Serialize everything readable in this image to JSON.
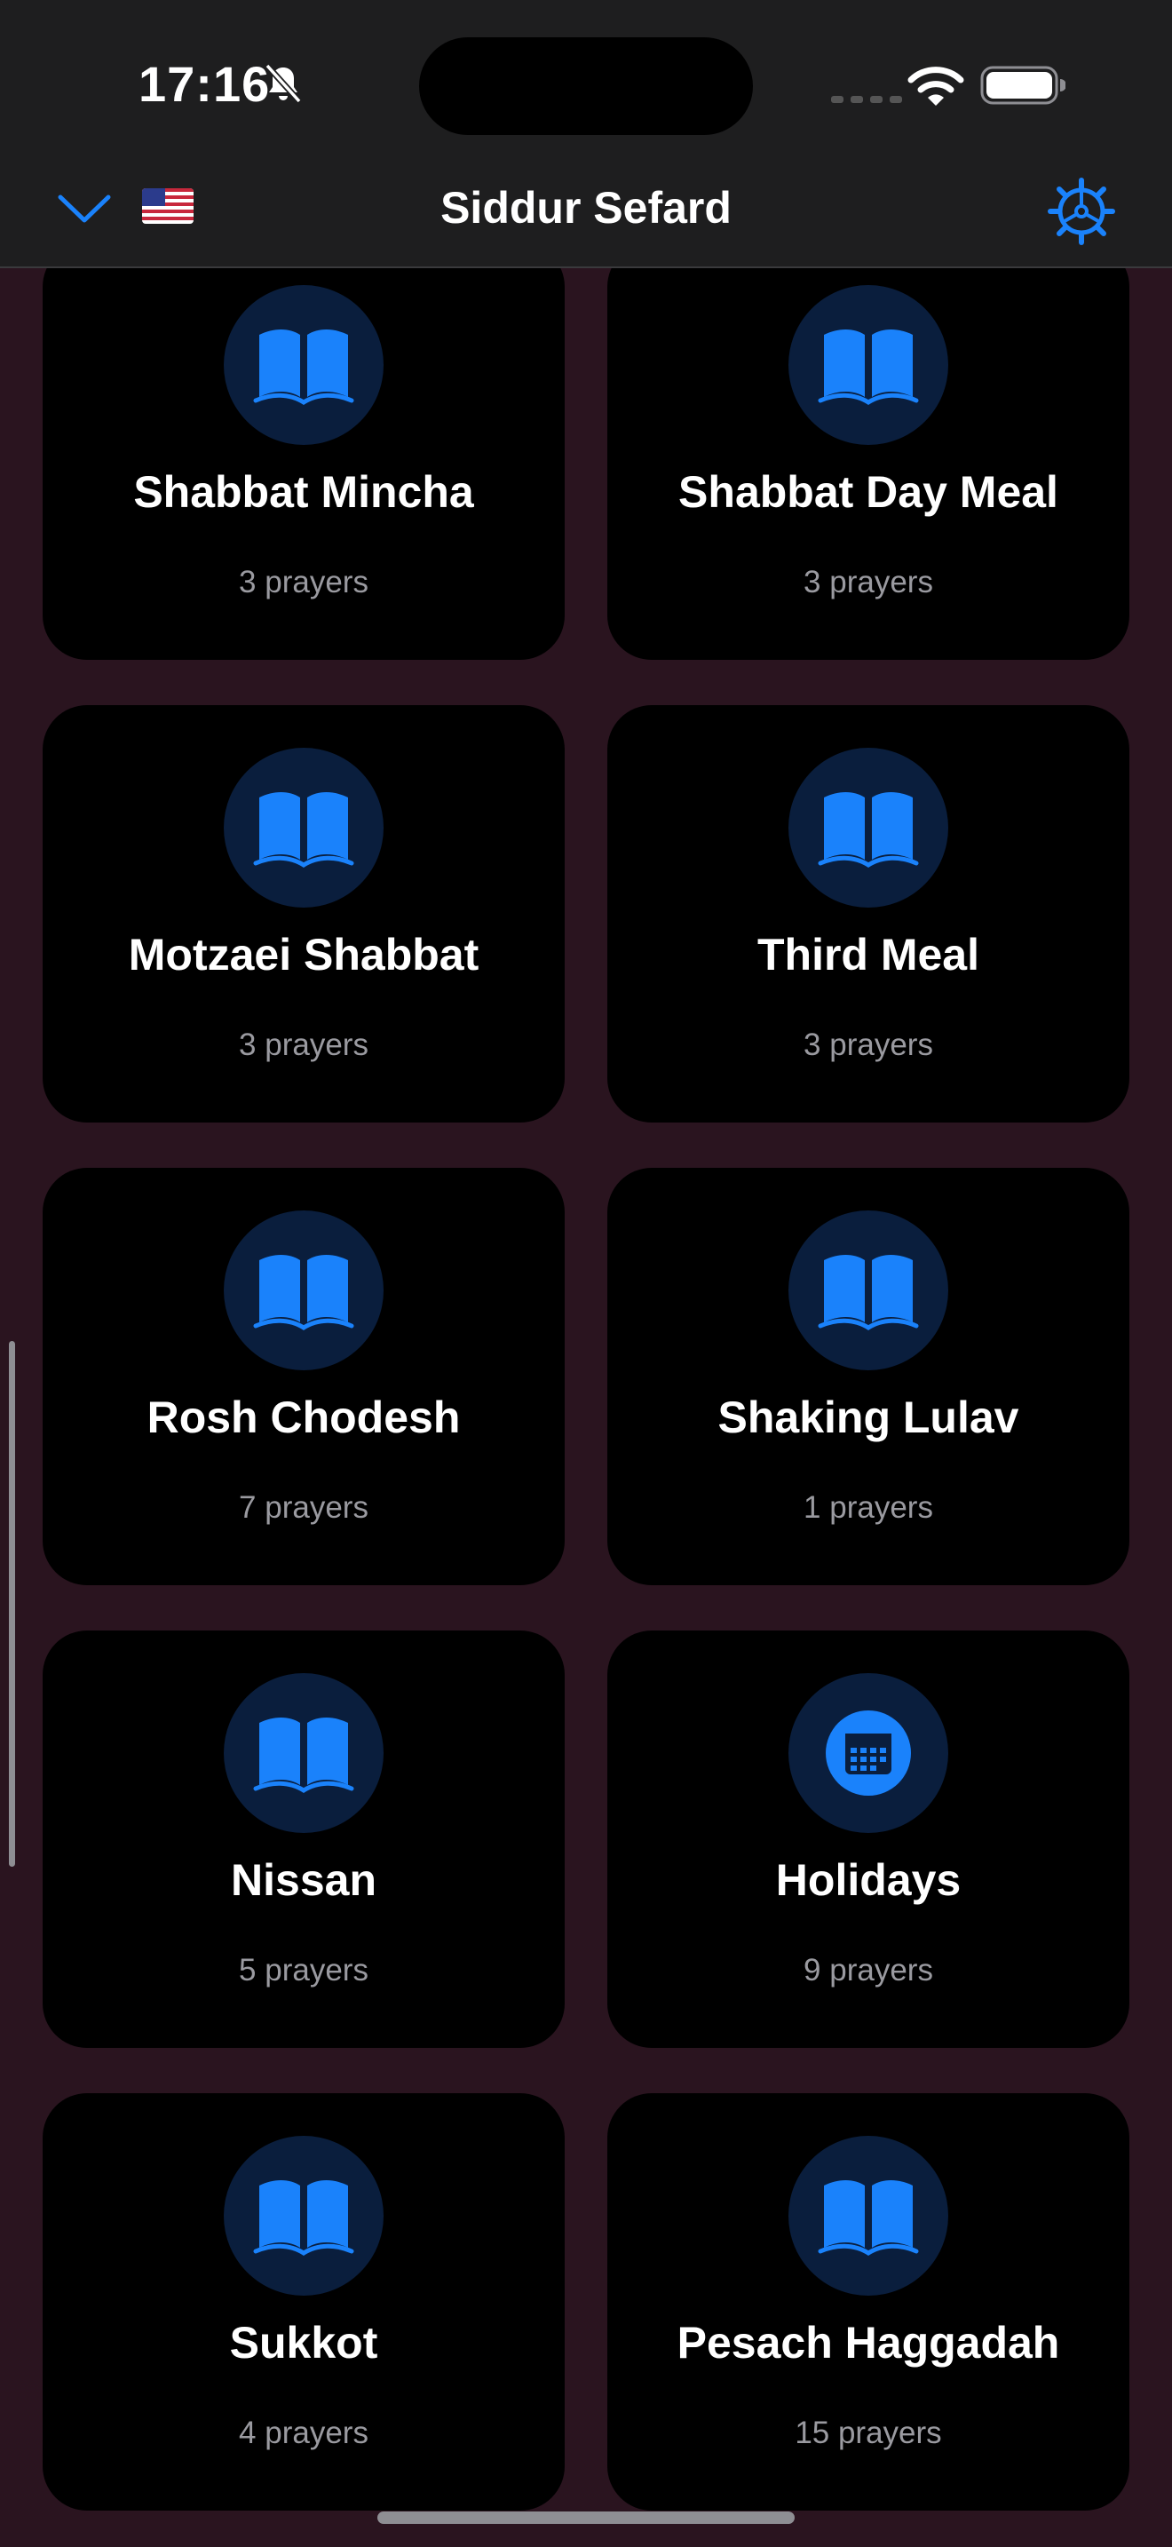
{
  "status_bar": {
    "time": "17:16"
  },
  "header": {
    "title": "Siddur Sefard"
  },
  "colors": {
    "accent": "#1a82fb",
    "card_bg": "#000000",
    "background": "#2a141f"
  },
  "categories": [
    {
      "title": "Shabbat Mincha",
      "count": "3 prayers",
      "icon": "book-icon"
    },
    {
      "title": "Shabbat Day Meal",
      "count": "3 prayers",
      "icon": "book-icon"
    },
    {
      "title": "Motzaei Shabbat",
      "count": "3 prayers",
      "icon": "book-icon"
    },
    {
      "title": "Third Meal",
      "count": "3 prayers",
      "icon": "book-icon"
    },
    {
      "title": "Rosh Chodesh",
      "count": "7 prayers",
      "icon": "book-icon"
    },
    {
      "title": "Shaking Lulav",
      "count": "1 prayers",
      "icon": "book-icon"
    },
    {
      "title": "Nissan",
      "count": "5 prayers",
      "icon": "book-icon"
    },
    {
      "title": "Holidays",
      "count": "9 prayers",
      "icon": "calendar-icon"
    },
    {
      "title": "Sukkot",
      "count": "4 prayers",
      "icon": "book-icon"
    },
    {
      "title": "Pesach Haggadah",
      "count": "15 prayers",
      "icon": "book-icon"
    }
  ]
}
